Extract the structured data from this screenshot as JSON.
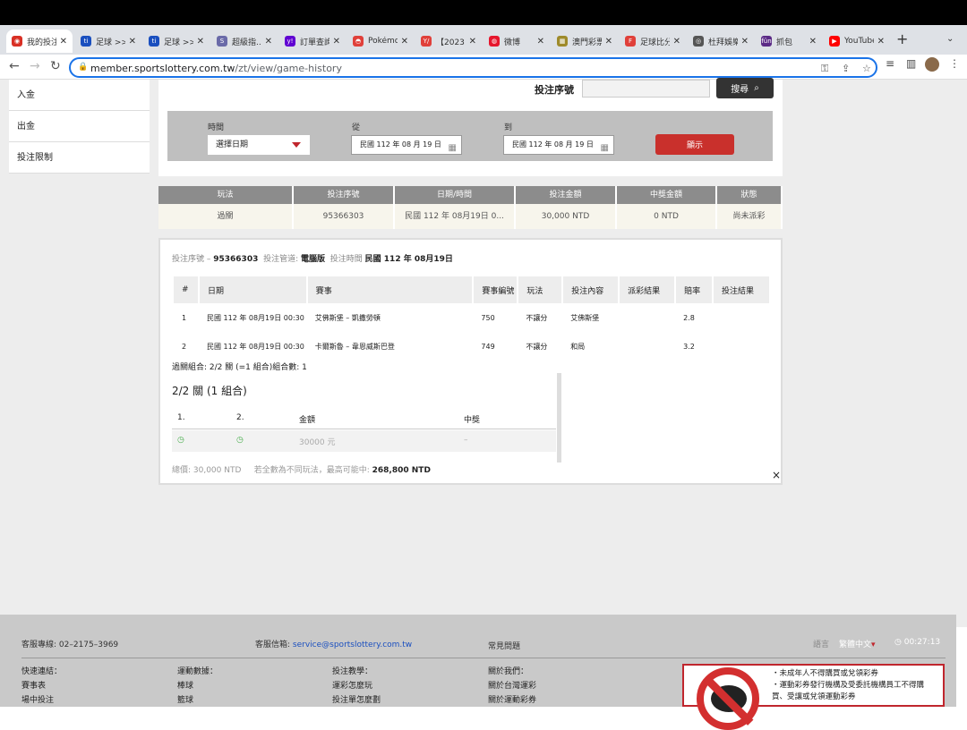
{
  "browser": {
    "tabs": [
      {
        "label": "我的投注",
        "color": "#d93025",
        "glyph": "◉"
      },
      {
        "label": "足球 >>",
        "color": "#1a4fbf",
        "glyph": "ti"
      },
      {
        "label": "足球 >>",
        "color": "#1a4fbf",
        "glyph": "ti"
      },
      {
        "label": "超級指...",
        "color": "#6a6aa8",
        "glyph": "S"
      },
      {
        "label": "訂單查詢",
        "color": "#6001d2",
        "glyph": "y!"
      },
      {
        "label": "Pokémon",
        "color": "#e0403a",
        "glyph": "◓"
      },
      {
        "label": "【2023",
        "color": "#e0403a",
        "glyph": "Y/"
      },
      {
        "label": "微博",
        "color": "#e6162d",
        "glyph": "◍"
      },
      {
        "label": "澳門彩票",
        "color": "#9e8a2a",
        "glyph": "▦"
      },
      {
        "label": "足球比分",
        "color": "#e0403a",
        "glyph": "F"
      },
      {
        "label": "杜拜娛樂",
        "color": "#555",
        "glyph": "◎"
      },
      {
        "label": "抓包",
        "color": "#5b2a86",
        "glyph": "fün"
      },
      {
        "label": "YouTube",
        "color": "#ff0000",
        "glyph": "▶"
      }
    ],
    "url_host": "member.sportslottery.com.tw",
    "url_path": "/zt/view/game-history"
  },
  "sidebar": {
    "items": [
      "入金",
      "出金",
      "投注限制"
    ]
  },
  "search": {
    "label": "投注序號",
    "placeholder": "",
    "button": "搜尋"
  },
  "filter": {
    "time_label": "時間",
    "time_value": "選擇日期",
    "from_label": "從",
    "from_value": "民國 112 年 08 月 19 日",
    "to_label": "到",
    "to_value": "民國 112 年 08 月 19 日",
    "show_button": "顯示"
  },
  "summary": {
    "headers": [
      "玩法",
      "投注序號",
      "日期/時間",
      "投注金額",
      "中獎金額",
      "狀態"
    ],
    "row": [
      "過關",
      "95366303",
      "民國 112 年 08月19日 0...",
      "30,000 NTD",
      "0 NTD",
      "尚未派彩"
    ]
  },
  "detail": {
    "meta_serial_label": "投注序號 –",
    "meta_serial": "95366303",
    "meta_channel_label": "投注管道:",
    "meta_channel": "電腦版",
    "meta_time_label": "投注時間",
    "meta_time": "民國 112 年 08月19日",
    "headers": [
      "#",
      "日期",
      "賽事",
      "賽事編號",
      "玩法",
      "投注內容",
      "派彩結果",
      "賠率",
      "投注結果"
    ],
    "rows": [
      [
        "1",
        "民國 112 年 08月19日 00:30",
        "艾佛斯堡 – 凱撒勞頓",
        "750",
        "不讓分",
        "艾佛斯堡",
        "",
        "2.8",
        ""
      ],
      [
        "2",
        "民國 112 年 08月19日 00:30",
        "卡爾斯魯 – 韋恩威斯巴登",
        "749",
        "不讓分",
        "和局",
        "",
        "3.2",
        ""
      ]
    ],
    "combo_note": "過關組合: 2/2 關 (=1 組合)組合數: 1",
    "combo_title": "2/2 關 (1 組合)",
    "combo_headers": [
      "1.",
      "2.",
      "金額",
      "中獎"
    ],
    "combo_row": [
      "◷",
      "◷",
      "30000 元",
      "–"
    ],
    "total_label": "總價: 30,000 NTD",
    "max_label": "若全數為不同玩法，最高可能中:",
    "max_value": "268,800 NTD",
    "close": "×"
  },
  "footer": {
    "hotline": "客服專線: 02–2175–3969",
    "mail_label": "客服信箱:",
    "mail": "service@sportslottery.com.tw",
    "faq": "常見問題",
    "lang_label": "語言",
    "lang": "繁體中文",
    "clock": "00:27:13",
    "cols": [
      {
        "title": "快速連結：",
        "items": [
          "賽事表",
          "場中投注"
        ]
      },
      {
        "title": "運動數據：",
        "items": [
          "棒球",
          "籃球"
        ]
      },
      {
        "title": "投注教學：",
        "items": [
          "運彩怎麼玩",
          "投注單怎麼劃"
        ]
      },
      {
        "title": "關於我們：",
        "items": [
          "關於台灣運彩",
          "關於運動彩券"
        ]
      }
    ],
    "warning": [
      "・未成年人不得購買或兌領彩券",
      "・運動彩券發行機構及受委託機構員工不得購",
      "  買、受讓或兌領運動彩券"
    ]
  }
}
